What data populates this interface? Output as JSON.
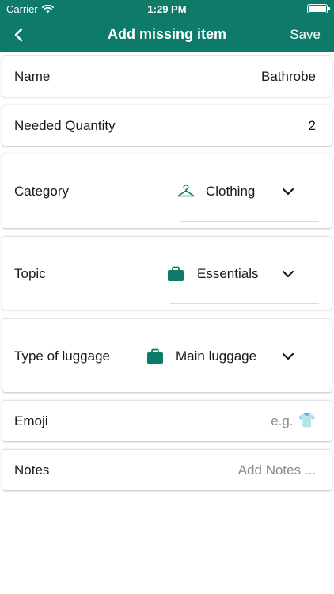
{
  "status": {
    "carrier": "Carrier",
    "time": "1:29 PM"
  },
  "nav": {
    "back_icon": "chevron-left-icon",
    "title": "Add missing item",
    "save": "Save"
  },
  "colors": {
    "brand": "#0e7a69",
    "text": "#1a1a1a",
    "placeholder": "#8a8a8a"
  },
  "form": {
    "name": {
      "label": "Name",
      "value": "Bathrobe"
    },
    "quantity": {
      "label": "Needed Quantity",
      "value": "2"
    },
    "category": {
      "label": "Category",
      "icon": "hanger-icon",
      "value": "Clothing"
    },
    "topic": {
      "label": "Topic",
      "icon": "briefcase-icon",
      "value": "Essentials"
    },
    "luggage": {
      "label": "Type of luggage",
      "icon": "briefcase-icon",
      "value": "Main luggage"
    },
    "emoji": {
      "label": "Emoji",
      "placeholder": "e.g.",
      "example": "👕"
    },
    "notes": {
      "label": "Notes",
      "placeholder": "Add Notes ..."
    }
  }
}
